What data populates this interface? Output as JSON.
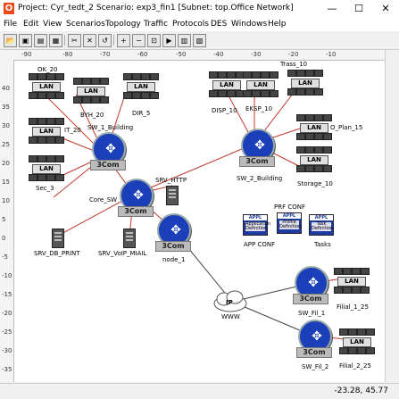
{
  "window": {
    "title": "Project: Cyr_tedt_2 Scenario: exp3_fin1  [Subnet: top.Office Network]",
    "app_icon": "O",
    "minimize": "—",
    "maximize": "☐",
    "close": "✕"
  },
  "menu": {
    "items": [
      "File",
      "Edit",
      "View",
      "Scenarios",
      "Topology",
      "Traffic",
      "Protocols",
      "DES",
      "Windows",
      "Help"
    ]
  },
  "toolbar": {
    "icons": [
      "open-folder-icon",
      "save-icon",
      "print-icon",
      "lock-icon",
      "cut-icon",
      "fail-node-icon",
      "recover-node-icon",
      "zoom-in-icon",
      "zoom-out-icon",
      "zoom-fit-icon",
      "configure-run-icon",
      "view-results-icon",
      "hide-graphs-icon"
    ]
  },
  "rulers": {
    "x": [
      "-90",
      "-80",
      "-70",
      "-60",
      "-50",
      "-40",
      "-30",
      "-20",
      "-10"
    ],
    "y": [
      "40",
      "35",
      "30",
      "25",
      "20",
      "15",
      "10",
      "5",
      "0",
      "-5",
      "-10",
      "-15",
      "-20",
      "-25",
      "-30",
      "-35",
      "-40"
    ]
  },
  "nodes": {
    "lans": [
      "OK_20",
      "BYH_20",
      "DIR_5",
      "DISP_10",
      "EKSP_10",
      "Trass_10",
      "IT_20",
      "O_Plan_15",
      "Sec_3",
      "Storage_10",
      "Filial_1_25",
      "Filial_2_25"
    ],
    "routers": [
      "SW_1_Building",
      "Core_SW",
      "SW_2_Building",
      "node_1",
      "SW_Fil_1",
      "SW_Fil_2"
    ],
    "servers": [
      "SRV_DB_PRINT",
      "SRV_VoIP_MIAIL",
      "SRV_HTTP"
    ],
    "apps": [
      "PRF CONF",
      "APP CONF",
      "Tasks"
    ],
    "cloud": "WWW",
    "lan_label": "LAN",
    "router_brand": "3Com",
    "app_tiles": {
      "appl": "APPL",
      "app_def": "Application Definition",
      "profile_def": "Profile Definition",
      "task_def": "Task Definition"
    },
    "cloud_label": "IP"
  },
  "status": {
    "coords": "-23.28, 45.77"
  },
  "colors": {
    "router": "#1a3fb8",
    "link_red": "#c0392b",
    "link_dark": "#444444",
    "app": "#1e3a9e"
  }
}
